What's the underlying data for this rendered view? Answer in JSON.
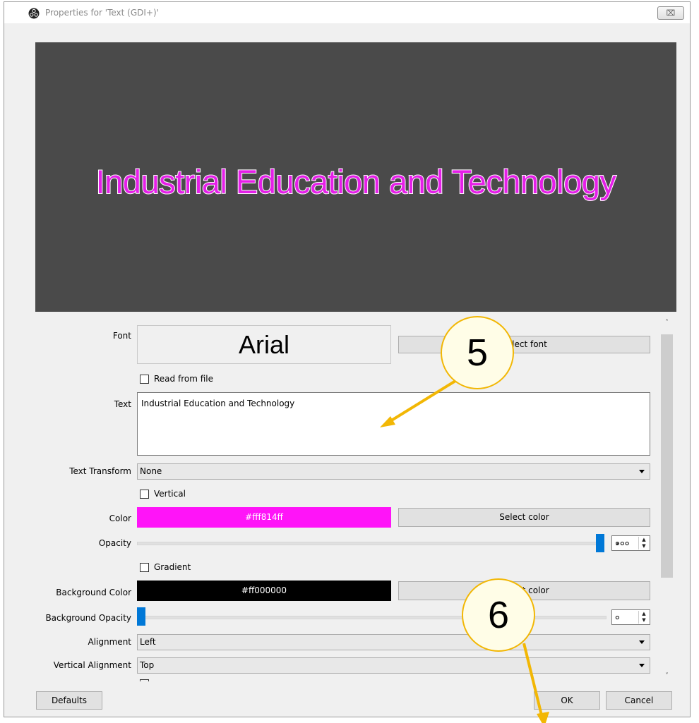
{
  "window": {
    "title": "Properties for 'Text (GDI+)'",
    "close_glyph": "⌧"
  },
  "preview": {
    "text": "Industrial Education and Technology",
    "fill_color": "#e51fe8",
    "outline_color": "#ffffff",
    "background": "#4a4a4a"
  },
  "form": {
    "font": {
      "label": "Font",
      "value": "Arial",
      "button": "Select font"
    },
    "read_from_file": {
      "label": "Read from file",
      "checked": false
    },
    "text": {
      "label": "Text",
      "value": "Industrial Education and Technology"
    },
    "text_transform": {
      "label": "Text Transform",
      "value": "None"
    },
    "vertical": {
      "label": "Vertical",
      "checked": false
    },
    "color": {
      "label": "Color",
      "value": "#fff814ff",
      "swatch": "#ff14f8",
      "button": "Select color"
    },
    "opacity": {
      "label": "Opacity",
      "value": "๑๐๐",
      "level": 100
    },
    "gradient": {
      "label": "Gradient",
      "checked": false
    },
    "bg_color": {
      "label": "Background Color",
      "value": "#ff000000",
      "swatch": "#000000",
      "button": "Select color"
    },
    "bg_opacity": {
      "label": "Background Opacity",
      "value": "๐",
      "level": 0
    },
    "alignment": {
      "label": "Alignment",
      "value": "Left"
    },
    "vertical_alignment": {
      "label": "Vertical Alignment",
      "value": "Top"
    }
  },
  "buttons": {
    "defaults": "Defaults",
    "ok": "OK",
    "cancel": "Cancel"
  },
  "callouts": {
    "step5": "5",
    "step6": "6",
    "color": "#f2b705"
  }
}
